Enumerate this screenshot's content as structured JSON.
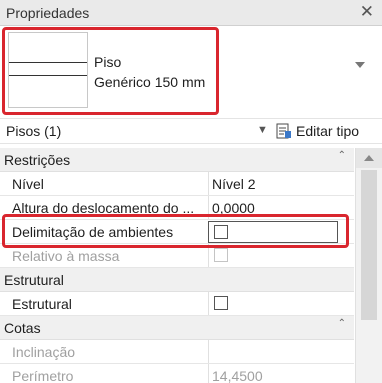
{
  "panel": {
    "title": "Propriedades",
    "close_glyph": "✕"
  },
  "type_selector": {
    "line1": "Piso",
    "line2": "Genérico 150 mm",
    "icon": "dropdown-triangle-icon"
  },
  "instance_selector": {
    "label": "Pisos (1)",
    "edit_type_label": "Editar tipo"
  },
  "groups": {
    "restricoes": {
      "label": "Restrições",
      "rows": [
        {
          "label": "Nível",
          "value": "Nível 2"
        },
        {
          "label": "Altura do deslocamento do ...",
          "value": "0,0000"
        },
        {
          "label": "Delimitação de ambientes",
          "value": ""
        },
        {
          "label": "Relativo à massa",
          "value": ""
        }
      ]
    },
    "estrutural": {
      "label": "Estrutural",
      "rows": [
        {
          "label": "Estrutural",
          "value": ""
        }
      ]
    },
    "cotas": {
      "label": "Cotas",
      "rows": [
        {
          "label": "Inclinação",
          "value": ""
        },
        {
          "label": "Perímetro",
          "value": "14,4500"
        }
      ]
    }
  },
  "colors": {
    "highlight": "#d9262e"
  }
}
